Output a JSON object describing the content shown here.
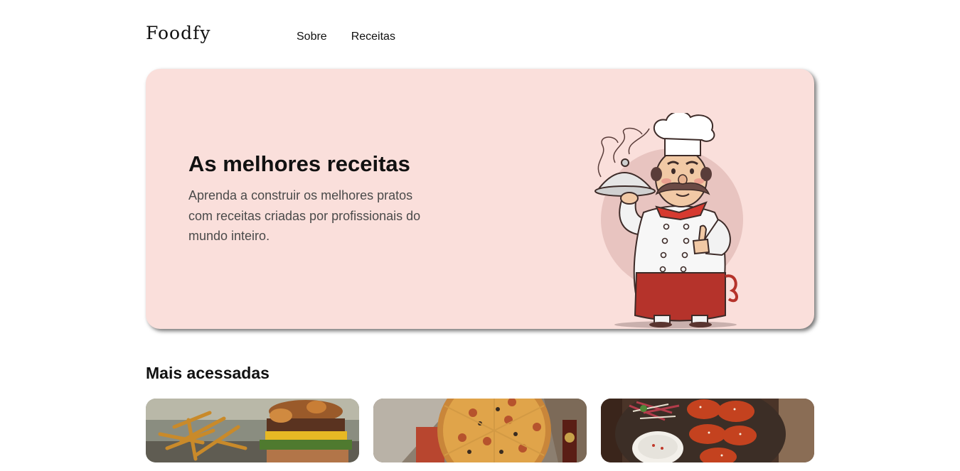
{
  "header": {
    "logo": "Foodfy",
    "nav": [
      {
        "label": "Sobre"
      },
      {
        "label": "Receitas"
      }
    ]
  },
  "hero": {
    "title": "As melhores receitas",
    "text": "Aprenda a construir os melhores pratos com receitas criadas por profissionais do mundo inteiro.",
    "illustration": "chef-illustration",
    "background_color": "#fadfdb"
  },
  "section": {
    "title": "Mais acessadas"
  },
  "recipes": [
    {
      "image": "burger-fries-photo"
    },
    {
      "image": "pizza-photo"
    },
    {
      "image": "chicken-wings-photo"
    }
  ]
}
